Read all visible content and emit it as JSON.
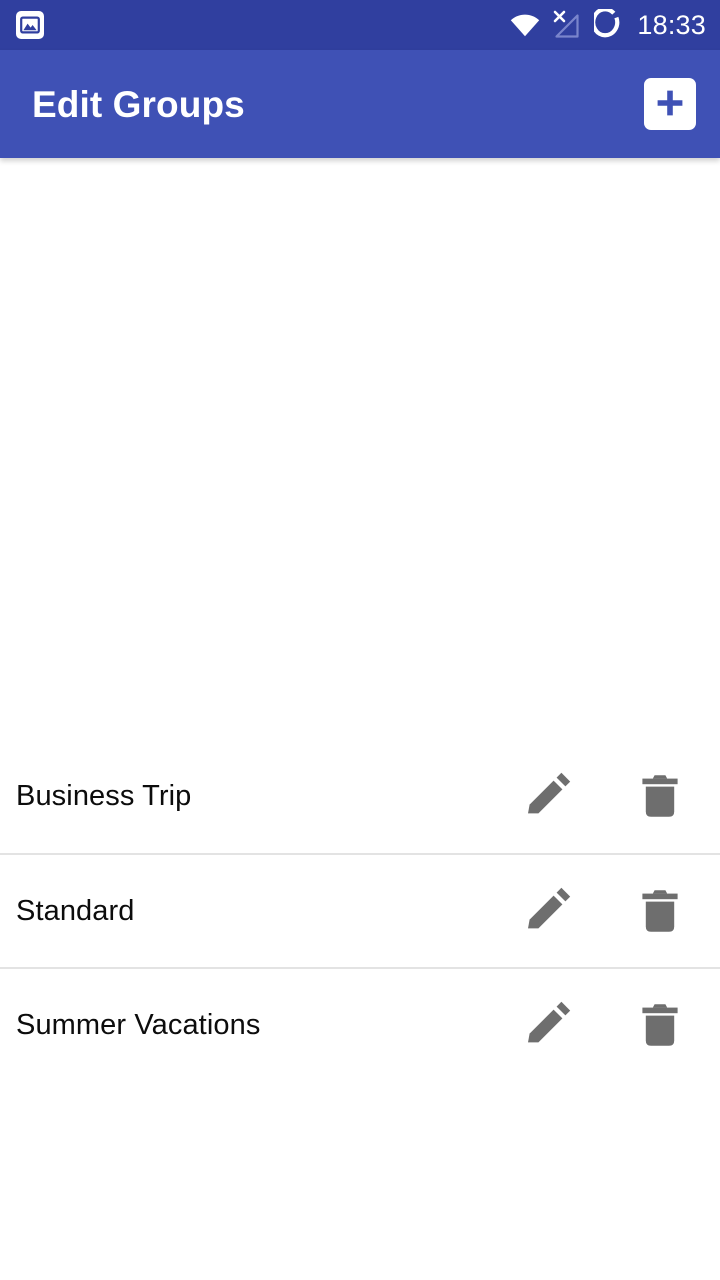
{
  "status_bar": {
    "time": "18:33",
    "background_color": "#303F9F",
    "icons": [
      {
        "name": "photo-notification-icon",
        "label": "photo"
      },
      {
        "name": "wifi-icon",
        "label": "wifi-full"
      },
      {
        "name": "cellular-no-signal-icon",
        "label": "mobile-network-off"
      },
      {
        "name": "battery-ring-icon",
        "label": "battery"
      }
    ]
  },
  "app_bar": {
    "title": "Edit Groups",
    "background_color": "#3F51B5",
    "add_button_label": "+",
    "add_button_name": "add-group-button"
  },
  "groups": {
    "rows": [
      {
        "name": "Business Trip",
        "edit_label": "Edit",
        "delete_label": "Delete"
      },
      {
        "name": "Standard",
        "edit_label": "Edit",
        "delete_label": "Delete"
      },
      {
        "name": "Summer Vacations",
        "edit_label": "Edit",
        "delete_label": "Delete"
      }
    ],
    "divider_color": "#E3E3E3",
    "icon_color": "#6E6E6E",
    "text_color": "#0C0C0C"
  }
}
